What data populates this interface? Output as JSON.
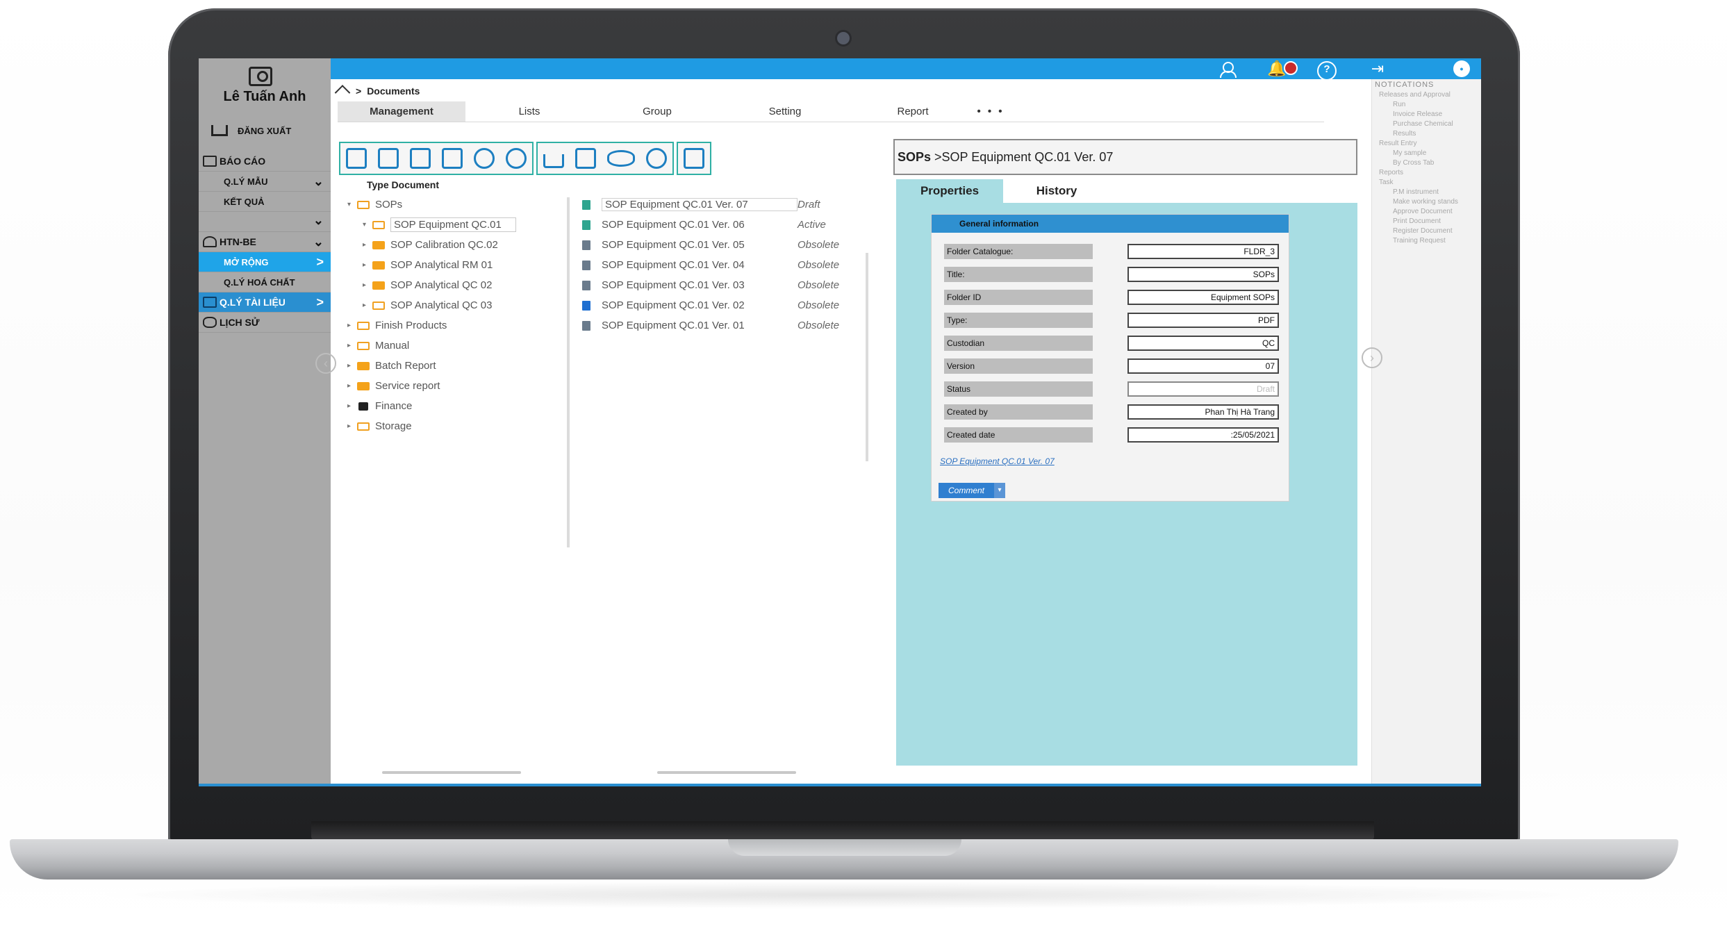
{
  "user": {
    "name": "Lê Tuấn Anh",
    "logout_label": "ĐĂNG XUẤT"
  },
  "sidebar": {
    "items": [
      {
        "label": "BÁO CÁO"
      },
      {
        "label": "Q.LÝ MẪU"
      },
      {
        "label": "KẾT QUẢ"
      },
      {
        "label": "HTN-BE"
      },
      {
        "label": "MỞ RỘNG"
      },
      {
        "label": "Q.LÝ HOÁ CHẤT"
      },
      {
        "label": "Q.LÝ TÀI LIỆU"
      },
      {
        "label": "LỊCH SỬ"
      }
    ]
  },
  "breadcrumb": {
    "current": "Documents"
  },
  "tabs": [
    {
      "label": "Management"
    },
    {
      "label": "Lists"
    },
    {
      "label": "Group"
    },
    {
      "label": "Setting"
    },
    {
      "label": "Report"
    },
    {
      "label": "• • •"
    }
  ],
  "toolbar": {
    "groups": [
      [
        "new-folder-icon",
        "add-document-icon",
        "new-document-icon",
        "copy-document-icon",
        "delete-icon",
        "approve-icon"
      ],
      [
        "download-icon",
        "print-icon",
        "preview-icon",
        "assign-user-icon"
      ],
      [
        "export-document-icon"
      ]
    ]
  },
  "tree": {
    "header": "Type Document",
    "nodes": [
      {
        "label": "SOPs"
      },
      {
        "label": "SOP Equipment QC.01"
      },
      {
        "label": "SOP Calibration QC.02"
      },
      {
        "label": "SOP Analytical  RM 01"
      },
      {
        "label": "SOP Analytical QC 02"
      },
      {
        "label": "SOP Analytical QC 03"
      },
      {
        "label": "Finish Products"
      },
      {
        "label": "Manual"
      },
      {
        "label": "Batch Report"
      },
      {
        "label": "Service report"
      },
      {
        "label": "Finance"
      },
      {
        "label": "Storage"
      }
    ]
  },
  "files": [
    {
      "name": "SOP Equipment QC.01 Ver. 07",
      "status": "Draft"
    },
    {
      "name": "SOP Equipment QC.01 Ver. 06",
      "status": "Active"
    },
    {
      "name": "SOP Equipment QC.01 Ver. 05",
      "status": "Obsolete"
    },
    {
      "name": "SOP Equipment QC.01 Ver. 04",
      "status": "Obsolete"
    },
    {
      "name": "SOP Equipment QC.01 Ver. 03",
      "status": "Obsolete"
    },
    {
      "name": "SOP Equipment QC.01 Ver. 02",
      "status": "Obsolete"
    },
    {
      "name": "SOP Equipment QC.01 Ver. 01",
      "status": "Obsolete"
    }
  ],
  "details": {
    "title_bold": "SOPs",
    "title_rest": " >SOP Equipment QC.01 Ver. 07",
    "tabs": [
      {
        "label": "Properties"
      },
      {
        "label": "History"
      }
    ],
    "section_title": "General information",
    "fields": [
      {
        "label": "Folder Catalogue:",
        "value": "FLDR_3"
      },
      {
        "label": "Title:",
        "value": "SOPs"
      },
      {
        "label": "Folder ID",
        "value": "Equipment SOPs"
      },
      {
        "label": "Type:",
        "value": "PDF"
      },
      {
        "label": "Custodian",
        "value": "QC"
      },
      {
        "label": "Version",
        "value": "07"
      },
      {
        "label": "Status",
        "value": "Draft"
      },
      {
        "label": "Created by",
        "value": "Phan Thị Hà Trang"
      },
      {
        "label": "Created date",
        "value": ":25/05/2021"
      }
    ],
    "link": "SOP Equipment QC.01 Ver. 07",
    "comment_label": "Comment"
  },
  "notifications": {
    "title": "NOTICATIONS",
    "items": [
      {
        "text": "Releases and Approval",
        "indent": false
      },
      {
        "text": "Run",
        "indent": true
      },
      {
        "text": "Invoice Release",
        "indent": true
      },
      {
        "text": "Purchase Chemical",
        "indent": true
      },
      {
        "text": "Results",
        "indent": true
      },
      {
        "text": "Result Entry",
        "indent": false
      },
      {
        "text": "My sample",
        "indent": true
      },
      {
        "text": "By Cross Tab",
        "indent": true
      },
      {
        "text": "Reports",
        "indent": false
      },
      {
        "text": "Task",
        "indent": false
      },
      {
        "text": "P.M instrument",
        "indent": true
      },
      {
        "text": "Make working stands",
        "indent": true
      },
      {
        "text": "Approve Document",
        "indent": true
      },
      {
        "text": "Print Document",
        "indent": true
      },
      {
        "text": "Register Document",
        "indent": true
      },
      {
        "text": "Training Request",
        "indent": true
      }
    ]
  },
  "colors": {
    "accent": "#1f9be3",
    "panel": "#a8dde3",
    "sidebar": "#a9a9a9",
    "toolbar_border": "#2fb0a4"
  }
}
